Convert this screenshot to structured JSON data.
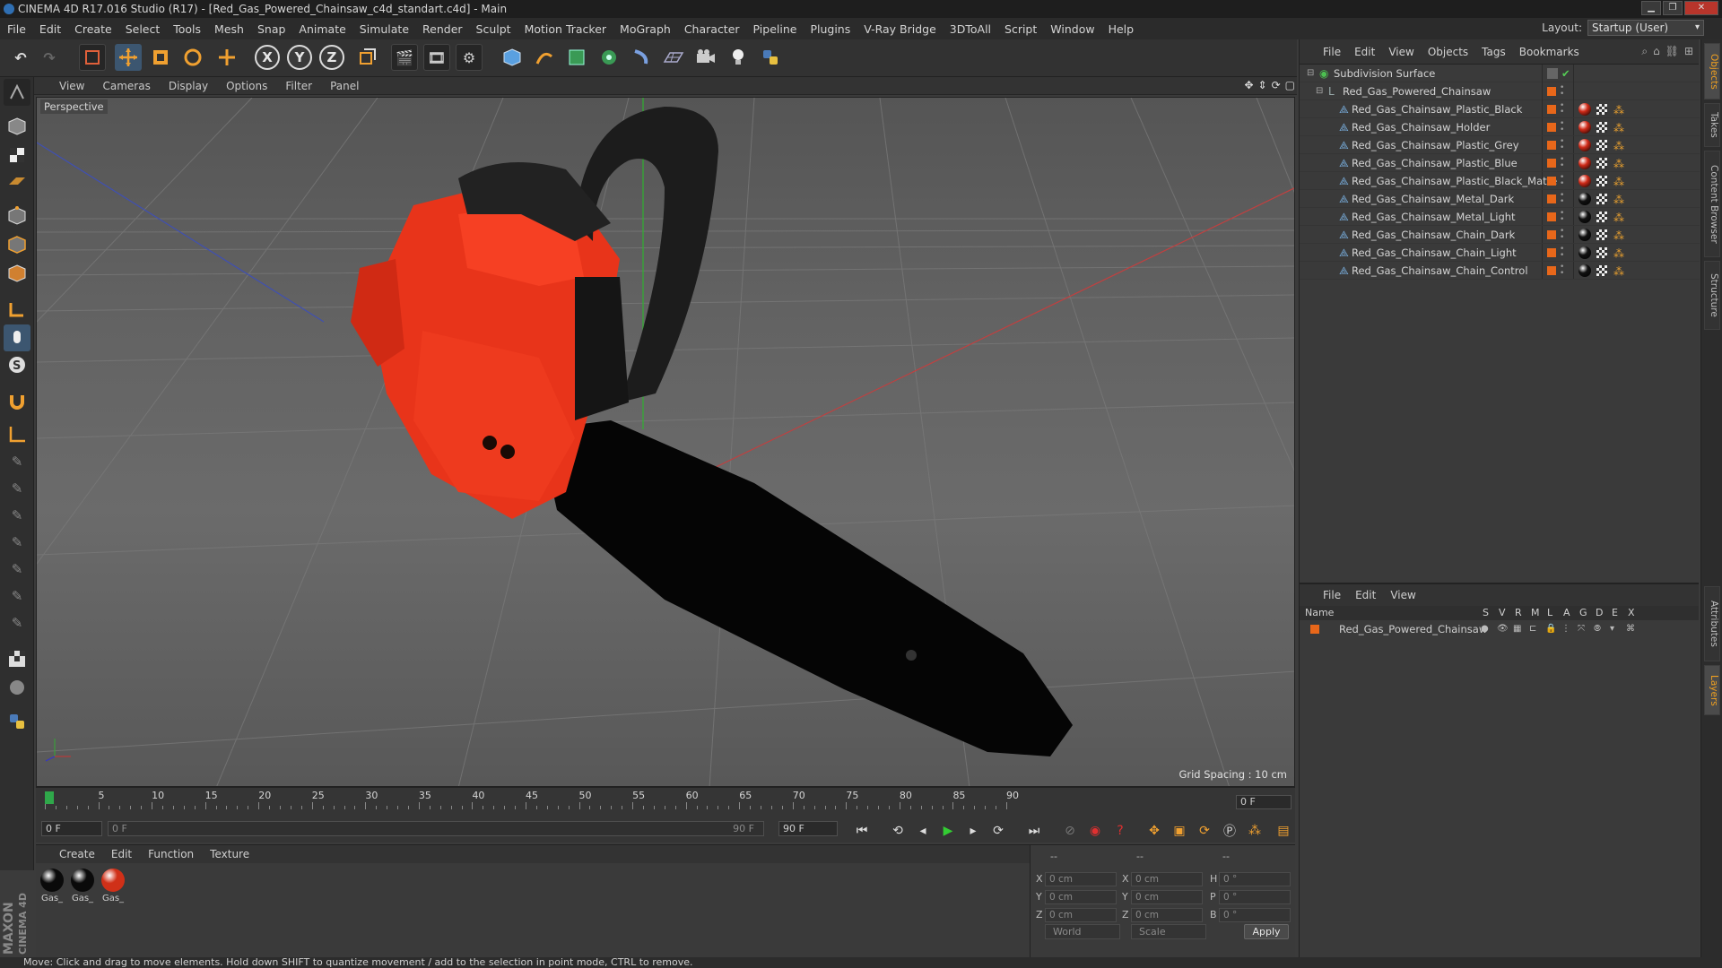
{
  "window": {
    "title": "CINEMA 4D R17.016 Studio (R17) - [Red_Gas_Powered_Chainsaw_c4d_standart.c4d] - Main"
  },
  "menubar": {
    "items": [
      "File",
      "Edit",
      "Create",
      "Select",
      "Tools",
      "Mesh",
      "Snap",
      "Animate",
      "Simulate",
      "Render",
      "Sculpt",
      "Motion Tracker",
      "MoGraph",
      "Character",
      "Pipeline",
      "Plugins",
      "V-Ray Bridge",
      "3DToAll",
      "Script",
      "Window",
      "Help"
    ],
    "layout_label": "Layout:",
    "layout_value": "Startup (User)"
  },
  "toolbar": {
    "axis_x": "X",
    "axis_y": "Y",
    "axis_z": "Z"
  },
  "viewport": {
    "menu": [
      "View",
      "Cameras",
      "Display",
      "Options",
      "Filter",
      "Panel"
    ],
    "camera_label": "Perspective",
    "grid_spacing": "Grid Spacing : 10 cm"
  },
  "timeline": {
    "ticks": [
      "0",
      "5",
      "10",
      "15",
      "20",
      "25",
      "30",
      "35",
      "40",
      "45",
      "50",
      "55",
      "60",
      "65",
      "70",
      "75",
      "80",
      "85",
      "90"
    ],
    "current_frame": "0 F",
    "start_field": "0 F",
    "range_start": "0 F",
    "range_end": "90 F",
    "end_field": "90 F"
  },
  "materials": {
    "menu": [
      "Create",
      "Edit",
      "Function",
      "Texture"
    ],
    "items": [
      {
        "label": "Gas_",
        "color": "#0a0a0a"
      },
      {
        "label": "Gas_",
        "color": "#0a0a0a"
      },
      {
        "label": "Gas_",
        "color": "#d03018"
      }
    ]
  },
  "coords": {
    "header": [
      "--",
      "--",
      "--"
    ],
    "rows": [
      {
        "a": "X",
        "av": "0 cm",
        "b": "X",
        "bv": "0 cm",
        "c": "H",
        "cv": "0 °"
      },
      {
        "a": "Y",
        "av": "0 cm",
        "b": "Y",
        "bv": "0 cm",
        "c": "P",
        "cv": "0 °"
      },
      {
        "a": "Z",
        "av": "0 cm",
        "b": "Z",
        "bv": "0 cm",
        "c": "B",
        "cv": "0 °"
      }
    ],
    "mode": "World",
    "type": "Scale",
    "apply": "Apply"
  },
  "objects": {
    "menu": [
      "File",
      "Edit",
      "View",
      "Objects",
      "Tags",
      "Bookmarks"
    ],
    "root": "Subdivision Surface",
    "group": "Red_Gas_Powered_Chainsaw",
    "children": [
      {
        "name": "Red_Gas_Chainsaw_Plastic_Black",
        "mat": "#d02a18"
      },
      {
        "name": "Red_Gas_Chainsaw_Holder",
        "mat": "#d02a18"
      },
      {
        "name": "Red_Gas_Chainsaw_Plastic_Grey",
        "mat": "#d02a18"
      },
      {
        "name": "Red_Gas_Chainsaw_Plastic_Blue",
        "mat": "#d02a18"
      },
      {
        "name": "Red_Gas_Chainsaw_Plastic_Black_Matte",
        "mat": "#d02a18"
      },
      {
        "name": "Red_Gas_Chainsaw_Metal_Dark",
        "mat": "#111111"
      },
      {
        "name": "Red_Gas_Chainsaw_Metal_Light",
        "mat": "#111111"
      },
      {
        "name": "Red_Gas_Chainsaw_Chain_Dark",
        "mat": "#111111"
      },
      {
        "name": "Red_Gas_Chainsaw_Chain_Light",
        "mat": "#111111"
      },
      {
        "name": "Red_Gas_Chainsaw_Chain_Control",
        "mat": "#111111"
      }
    ]
  },
  "layers": {
    "menu": [
      "File",
      "Edit",
      "View"
    ],
    "header_name": "Name",
    "header_cols": [
      "S",
      "V",
      "R",
      "M",
      "L",
      "A",
      "G",
      "D",
      "E",
      "X"
    ],
    "row": "Red_Gas_Powered_Chainsaw"
  },
  "right_tabs": [
    "Objects",
    "Takes",
    "Content Browser",
    "Structure",
    "Attributes",
    "Layers"
  ],
  "status": "Move: Click and drag to move elements. Hold down SHIFT to quantize movement / add to the selection in point mode, CTRL to remove.",
  "branding": {
    "maxon": "MAXON",
    "cinema": "CINEMA 4D"
  },
  "colors": {
    "accent": "#e8671a",
    "chainsaw_body": "#e8341a"
  }
}
